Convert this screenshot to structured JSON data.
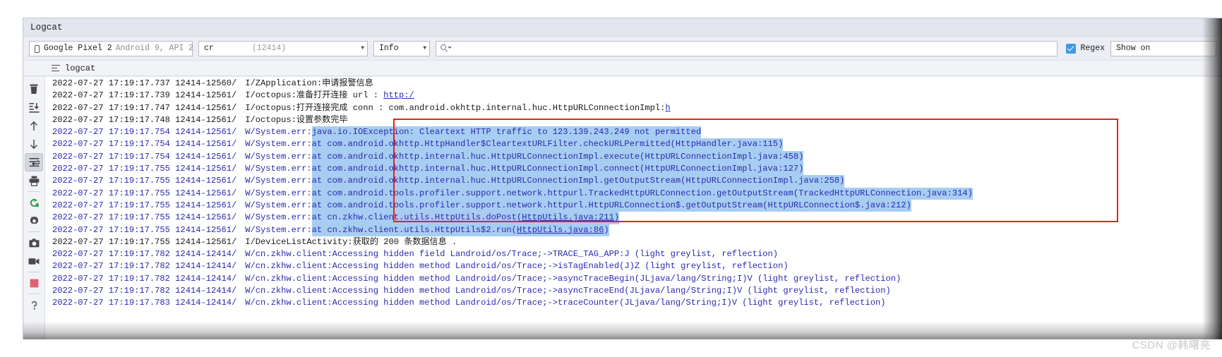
{
  "window": {
    "title": "Logcat"
  },
  "toolbar": {
    "device": {
      "name": "Google Pixel 2",
      "api": "Android 9, API 2",
      "icon": "phone-icon"
    },
    "process": {
      "name": "cr",
      "pid": "(12414)"
    },
    "level": "Info",
    "search_placeholder": "",
    "search_value": "",
    "search_icon": "search-icon",
    "regex_label": "Regex",
    "regex_checked": true,
    "show_only_label": "Show on"
  },
  "tabstrip": {
    "tab_label": "logcat",
    "tab_icon": "lines-icon"
  },
  "sidebar": {
    "items": [
      {
        "name": "clear-logcat-button",
        "icon": "trash-icon"
      },
      {
        "name": "scroll-to-end-button",
        "icon": "scroll-end-icon"
      },
      {
        "name": "up-button",
        "icon": "arrow-up-icon"
      },
      {
        "name": "down-button",
        "icon": "arrow-down-icon"
      },
      {
        "name": "soft-wrap-button",
        "icon": "soft-wrap-icon",
        "active": true
      },
      {
        "name": "print-button",
        "icon": "print-icon"
      },
      {
        "name": "restart-button",
        "icon": "restart-icon"
      },
      {
        "name": "settings-button",
        "icon": "gear-icon"
      },
      {
        "name": "screenshot-button",
        "icon": "camera-icon"
      },
      {
        "name": "screen-record-button",
        "icon": "video-camera-icon"
      },
      {
        "name": "stop-button",
        "icon": "stop-square-icon"
      },
      {
        "name": "help-button",
        "icon": "question-mark-icon"
      }
    ]
  },
  "annotation": {
    "type": "red-rectangle-highlight"
  },
  "watermark": "CSDN @韩曙亮",
  "log": {
    "rows": [
      {
        "ts": "2022-07-27 17:19:17.737 12414-12560/",
        "tag": "I/ZApplication:",
        "msg": " 申请报警信息",
        "color": "black",
        "selected": false
      },
      {
        "ts": "2022-07-27 17:19:17.739 12414-12561/",
        "tag": "I/octopus:",
        "msg": " 准备打开连接 url : ",
        "link": "http:/",
        "color": "black",
        "selected": false
      },
      {
        "ts": "2022-07-27 17:19:17.747 12414-12561/",
        "tag": "I/octopus:",
        "msg": " 打开连接完成 conn : com.android.okhttp.internal.huc.HttpURLConnectionImpl:",
        "link2": "h",
        "color": "black",
        "selected": false
      },
      {
        "ts": "2022-07-27 17:19:17.748 12414-12561/",
        "tag": "I/octopus:",
        "msg": " 设置参数完毕",
        "color": "black",
        "selected": false
      },
      {
        "ts": "2022-07-27 17:19:17.754 12414-12561/",
        "tag": "W/System.err:",
        "msg": " java.io.IOException: Cleartext HTTP traffic to 123.139.243.249 not permitted",
        "color": "blue",
        "selected": true
      },
      {
        "ts": "2022-07-27 17:19:17.754 12414-12561/",
        "tag": "W/System.err:",
        "msg": "     at com.android.okhttp.HttpHandler$CleartextURLFilter.checkURLPermitted(HttpHandler.java:115)",
        "color": "blue",
        "selected": true
      },
      {
        "ts": "2022-07-27 17:19:17.754 12414-12561/",
        "tag": "W/System.err:",
        "msg": "     at com.android.okhttp.internal.huc.HttpURLConnectionImpl.execute(HttpURLConnectionImpl.java:458)",
        "color": "blue",
        "selected": true
      },
      {
        "ts": "2022-07-27 17:19:17.755 12414-12561/",
        "tag": "W/System.err:",
        "msg": "     at com.android.okhttp.internal.huc.HttpURLConnectionImpl.connect(HttpURLConnectionImpl.java:127)",
        "color": "blue",
        "selected": true
      },
      {
        "ts": "2022-07-27 17:19:17.755 12414-12561/",
        "tag": "W/System.err:",
        "msg": "     at com.android.okhttp.internal.huc.HttpURLConnectionImpl.getOutputStream(HttpURLConnectionImpl.java:258)",
        "color": "blue",
        "selected": true
      },
      {
        "ts": "2022-07-27 17:19:17.755 12414-12561/",
        "tag": "W/System.err:",
        "msg": "     at com.android.tools.profiler.support.network.httpurl.TrackedHttpURLConnection.getOutputStream(TrackedHttpURLConnection.java:314)",
        "color": "blue",
        "selected": true
      },
      {
        "ts": "2022-07-27 17:19:17.755 12414-12561/",
        "tag": "W/System.err:",
        "msg": "     at com.android.tools.profiler.support.network.httpurl.HttpURLConnection$.getOutputStream(HttpURLConnection$.java:212)",
        "color": "blue",
        "selected": true
      },
      {
        "ts": "2022-07-27 17:19:17.755 12414-12561/",
        "tag": "W/System.err:",
        "msg": "     at cn.zkhw.client.utils.HttpUtils.doPost(",
        "link": "HttpUtils.java:211",
        "msg_after": ")",
        "color": "blue",
        "selected": true
      },
      {
        "ts": "2022-07-27 17:19:17.755 12414-12561/",
        "tag": "W/System.err:",
        "msg": "     at cn.zkhw.client.utils.HttpUtils$2.run(",
        "link": "HttpUtils.java:86",
        "msg_after": ")",
        "color": "blue",
        "selected": true
      },
      {
        "ts": "2022-07-27 17:19:17.755 12414-12561/",
        "tag": "I/DeviceListActivity:",
        "msg": " 获取的 200 条数据信息 .",
        "color": "black",
        "selected": false
      },
      {
        "ts": "2022-07-27 17:19:17.782 12414-12414/",
        "tag": "W/cn.zkhw.client:",
        "msg": " Accessing hidden field Landroid/os/Trace;->TRACE_TAG_APP:J (light greylist, reflection)",
        "color": "blue",
        "selected": false
      },
      {
        "ts": "2022-07-27 17:19:17.782 12414-12414/",
        "tag": "W/cn.zkhw.client:",
        "msg": " Accessing hidden method Landroid/os/Trace;->isTagEnabled(J)Z (light greylist, reflection)",
        "color": "blue",
        "selected": false
      },
      {
        "ts": "2022-07-27 17:19:17.782 12414-12414/",
        "tag": "W/cn.zkhw.client:",
        "msg": " Accessing hidden method Landroid/os/Trace;->asyncTraceBegin(JLjava/lang/String;I)V (light greylist, reflection)",
        "color": "blue",
        "selected": false
      },
      {
        "ts": "2022-07-27 17:19:17.782 12414-12414/",
        "tag": "W/cn.zkhw.client:",
        "msg": " Accessing hidden method Landroid/os/Trace;->asyncTraceEnd(JLjava/lang/String;I)V (light greylist, reflection)",
        "color": "blue",
        "selected": false
      },
      {
        "ts": "2022-07-27 17:19:17.783 12414-12414/",
        "tag": "W/cn.zkhw.client:",
        "msg": " Accessing hidden method Landroid/os/Trace;->traceCounter(JLjava/lang/String;I)V (light greylist, reflection)",
        "color": "blue",
        "selected": false
      }
    ]
  }
}
